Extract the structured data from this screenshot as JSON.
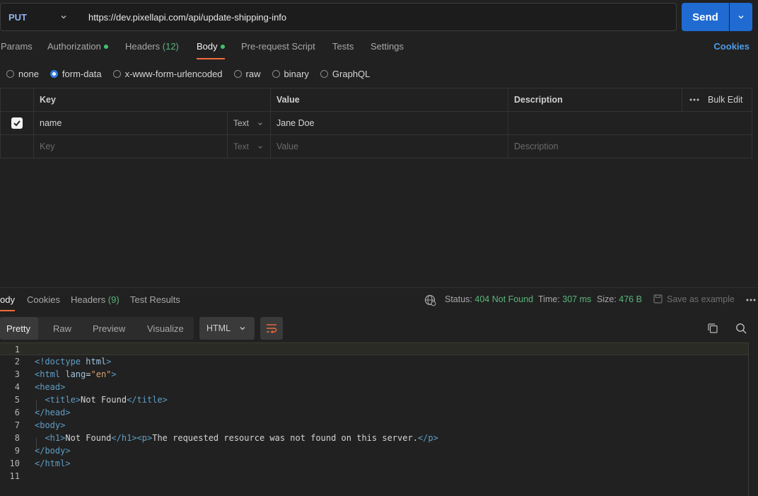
{
  "request": {
    "method": "PUT",
    "url": "https://dev.pixellapi.com/api/update-shipping-info",
    "send_label": "Send"
  },
  "request_tabs": {
    "params": "Params",
    "authorization": "Authorization",
    "headers": "Headers",
    "headers_count": "(12)",
    "body": "Body",
    "pre_request": "Pre-request Script",
    "tests": "Tests",
    "settings": "Settings",
    "cookies": "Cookies",
    "active": "Body"
  },
  "body_types": {
    "options": [
      "none",
      "form-data",
      "x-www-form-urlencoded",
      "raw",
      "binary",
      "GraphQL"
    ],
    "selected": "form-data"
  },
  "form_table": {
    "headers": {
      "key": "Key",
      "value": "Value",
      "description": "Description",
      "bulk_edit": "Bulk Edit"
    },
    "rows": [
      {
        "checked": true,
        "key": "name",
        "type": "Text",
        "value": "Jane Doe",
        "description": ""
      }
    ],
    "placeholder": {
      "key": "Key",
      "type": "Text",
      "value": "Value",
      "description": "Description"
    }
  },
  "response": {
    "tabs": {
      "body": "ody",
      "cookies": "Cookies",
      "headers": "Headers",
      "headers_count": "(9)",
      "test_results": "Test Results"
    },
    "status_label": "Status:",
    "status_value": "404 Not Found",
    "time_label": "Time:",
    "time_value": "307 ms",
    "size_label": "Size:",
    "size_value": "476 B",
    "save_example": "Save as example",
    "view_modes": [
      "Pretty",
      "Raw",
      "Preview",
      "Visualize"
    ],
    "active_view": "Pretty",
    "format": "HTML",
    "status_color": "#5ab57a"
  },
  "code_lines": [
    "",
    "<!doctype html>",
    "<html lang=\"en\">",
    "<head>",
    "  <title>Not Found</title>",
    "</head>",
    "<body>",
    "  <h1>Not Found</h1><p>The requested resource was not found on this server.</p>",
    "</body>",
    "</html>",
    ""
  ],
  "colors": {
    "accent": "#f26b3a",
    "send": "#1f6bd1",
    "method": "#8fb3ee",
    "link": "#4d9ce6",
    "success": "#3ec46d"
  }
}
